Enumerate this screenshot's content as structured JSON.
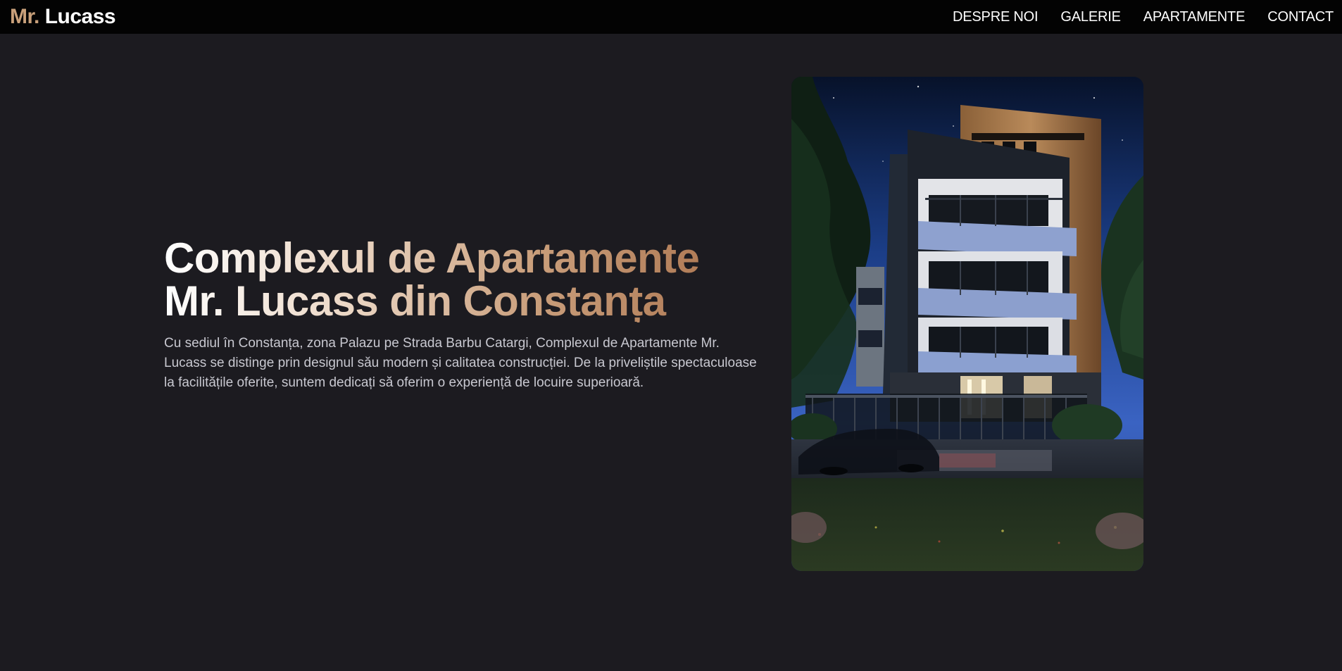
{
  "header": {
    "logo_prefix": "Mr.",
    "logo_name": "Lucass",
    "nav": [
      {
        "label": "DESPRE NOI"
      },
      {
        "label": "GALERIE"
      },
      {
        "label": "APARTAMENTE"
      },
      {
        "label": "CONTACT"
      }
    ]
  },
  "hero": {
    "title_line1": "Complexul de Apartamente",
    "title_line2": "Mr. Lucass din Constanța",
    "description": "Cu sediul în Constanța, zona Palazu pe Strada Barbu Catargi, Complexul de Apartamente Mr. Lucass se distinge prin designul său modern și calitatea construcției. De la priveliștile spectaculoase la facilitățile oferite, suntem dedicați să oferim o experiență de locuire superioară."
  },
  "colors": {
    "background": "#1c1b20",
    "header": "#030303",
    "accent": "#c9a07a"
  }
}
